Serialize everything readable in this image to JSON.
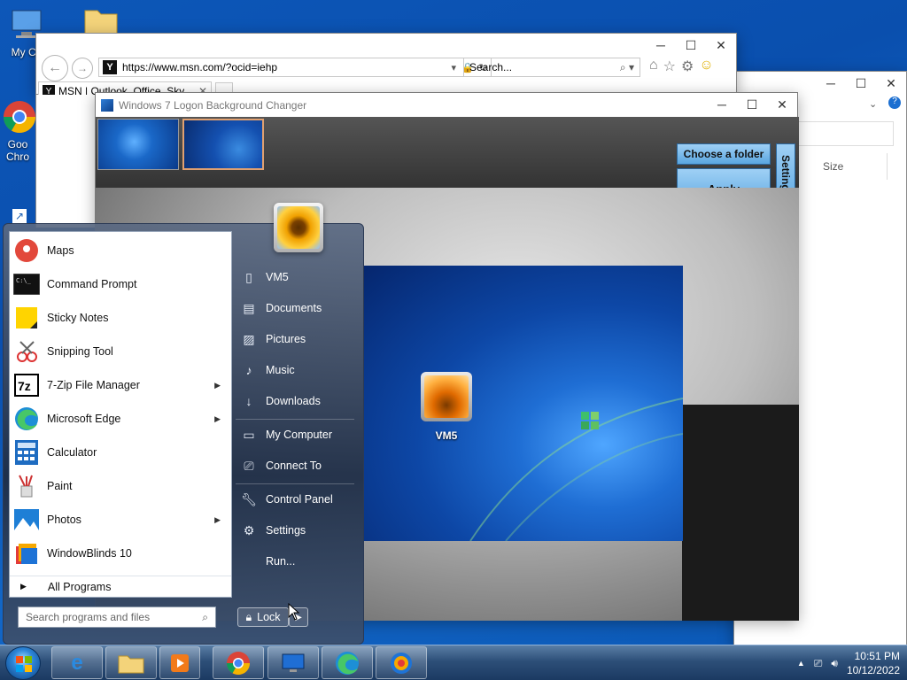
{
  "desktop": {
    "icons": [
      {
        "label": "My Co",
        "icon": "computer-icon"
      },
      {
        "label": "Goo Chro",
        "icon": "chrome-icon"
      },
      {
        "label": "",
        "icon": "folder-icon"
      }
    ]
  },
  "ie": {
    "url": "https://www.msn.com/?ocid=iehp",
    "search_placeholder": "Search...",
    "tab_label": "MSN | Outlook, Office, Sky"
  },
  "explorer": {
    "column_size": "Size"
  },
  "logon": {
    "title": "Windows 7 Logon Background Changer",
    "choose_folder": "Choose a folder",
    "apply": "Apply",
    "settings": "Settings",
    "user_label": "VM5"
  },
  "startmenu": {
    "programs": [
      {
        "label": "Maps",
        "icon": "maps-icon",
        "submenu": false
      },
      {
        "label": "Command Prompt",
        "icon": "cmd-icon",
        "submenu": false
      },
      {
        "label": "Sticky Notes",
        "icon": "sticky-notes-icon",
        "submenu": false
      },
      {
        "label": "Snipping Tool",
        "icon": "snipping-tool-icon",
        "submenu": false
      },
      {
        "label": "7-Zip File Manager",
        "icon": "7zip-icon",
        "submenu": true
      },
      {
        "label": "Microsoft Edge",
        "icon": "edge-icon",
        "submenu": true
      },
      {
        "label": "Calculator",
        "icon": "calculator-icon",
        "submenu": false
      },
      {
        "label": "Paint",
        "icon": "paint-icon",
        "submenu": false
      },
      {
        "label": "Photos",
        "icon": "photos-icon",
        "submenu": true
      },
      {
        "label": "WindowBlinds 10",
        "icon": "windowblinds-icon",
        "submenu": false
      }
    ],
    "all_programs": "All Programs",
    "search_placeholder": "Search programs and files",
    "right": {
      "user": "VM5",
      "documents": "Documents",
      "pictures": "Pictures",
      "music": "Music",
      "downloads": "Downloads",
      "my_computer": "My Computer",
      "connect_to": "Connect To",
      "control_panel": "Control Panel",
      "settings": "Settings",
      "run": "Run..."
    },
    "lock": "Lock"
  },
  "taskbar": {
    "apps": [
      "internet-explorer-icon",
      "file-explorer-icon",
      "media-player-icon",
      "chrome-icon",
      "logon-changer-icon",
      "edge-icon",
      "windowblinds-icon"
    ],
    "time": "10:51 PM",
    "date": "10/12/2022"
  }
}
